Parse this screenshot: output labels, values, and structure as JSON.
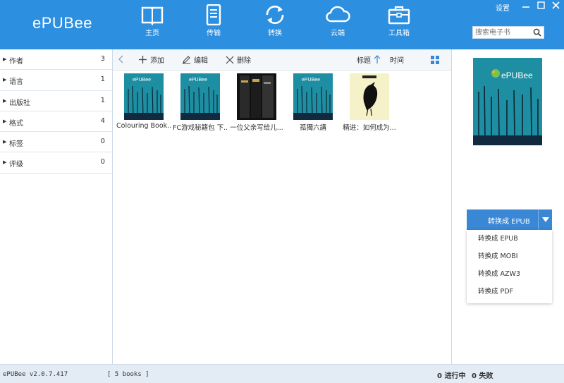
{
  "app": {
    "title": "ePUBee"
  },
  "header": {
    "nav": [
      {
        "label": "主页",
        "icon": "book-open-icon"
      },
      {
        "label": "传输",
        "icon": "device-transfer-icon"
      },
      {
        "label": "转换",
        "icon": "refresh-icon"
      },
      {
        "label": "云端",
        "icon": "cloud-icon"
      },
      {
        "label": "工具箱",
        "icon": "toolbox-icon"
      }
    ],
    "settings_label": "设置",
    "search_placeholder": "搜索电子书"
  },
  "sidebar": {
    "items": [
      {
        "label": "作者",
        "count": "3"
      },
      {
        "label": "语言",
        "count": "1"
      },
      {
        "label": "出版社",
        "count": "1"
      },
      {
        "label": "格式",
        "count": "4"
      },
      {
        "label": "标签",
        "count": "0"
      },
      {
        "label": "评级",
        "count": "0"
      }
    ]
  },
  "toolbar": {
    "add_label": "添加",
    "edit_label": "编辑",
    "delete_label": "删除",
    "sort_title_label": "标题",
    "sort_time_label": "时间"
  },
  "books": [
    {
      "title": "Colouring Book...",
      "cover_brand": "ePUBee"
    },
    {
      "title": "FC游戏秘籍包 下...",
      "cover_brand": "ePUBee"
    },
    {
      "title": "一位父亲写给儿...",
      "cover_brand": ""
    },
    {
      "title": "孤獨六講",
      "cover_brand": "ePUBee"
    },
    {
      "title": "精进：如何成为...",
      "cover_brand": ""
    }
  ],
  "preview": {
    "cover_brand": "ePUBee"
  },
  "convert": {
    "button_label": "转换成 EPUB",
    "options": [
      "转换成 EPUB",
      "转换成 MOBI",
      "转换成 AZW3",
      "转换成 PDF"
    ]
  },
  "status": {
    "version": "ePUBee v2.0.7.417",
    "book_count": "[ 5 books ]",
    "in_progress": "0 进行中",
    "failed": "0 失败"
  },
  "colors": {
    "header": "#2d8fe0",
    "accent": "#3a87d6",
    "cover": "#1e8fa3"
  }
}
